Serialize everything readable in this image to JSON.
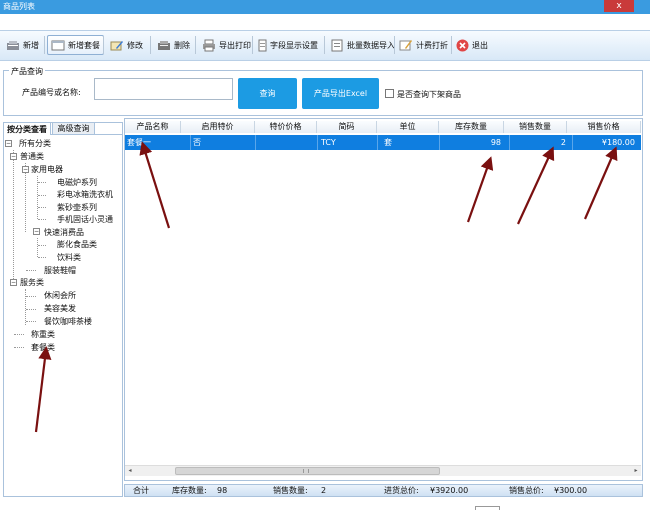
{
  "window": {
    "title": "商品列表",
    "close_glyph": "x"
  },
  "toolbar": {
    "items": [
      {
        "label": "新增",
        "icon": "add-icon"
      },
      {
        "label": "新增套餐",
        "icon": "package-add-icon"
      },
      {
        "label": "修改",
        "icon": "edit-icon"
      },
      {
        "label": "删除",
        "icon": "delete-icon"
      },
      {
        "label": "导出打印",
        "icon": "printer-icon"
      },
      {
        "label": "字段显示设置",
        "icon": "field-settings-icon"
      },
      {
        "label": "批量数据导入",
        "icon": "batch-import-icon"
      },
      {
        "label": "计费打折",
        "icon": "discount-icon"
      },
      {
        "label": "退出",
        "icon": "exit-icon"
      }
    ]
  },
  "query": {
    "legend": "产品查询",
    "code_label": "产品编号或名称:",
    "code_value": "",
    "query_button": "查询",
    "export_button": "产品导出Excel",
    "offshelf_label": "是否查询下架商品",
    "offshelf_checked": false
  },
  "left_tabs": {
    "by_category": "按分类查看",
    "advanced": "高级查询"
  },
  "tree": {
    "root": "所有分类",
    "normal": "普通类",
    "appliance": "家用电器",
    "appliance_children": [
      "电磁炉系列",
      "彩电冰箱洗衣机",
      "紫砂壶系列",
      "手机固话小灵通"
    ],
    "fmcg": "快速消费品",
    "fmcg_children": [
      "膨化食品类",
      "饮料类"
    ],
    "clothing": "服装鞋帽",
    "service": "服务类",
    "service_children": [
      "休闲会所",
      "美容美发",
      "餐饮咖啡茶楼"
    ],
    "weighing": "称重类",
    "package": "套餐类"
  },
  "grid": {
    "columns": [
      "产品名称",
      "启用特价",
      "特价价格",
      "简码",
      "单位",
      "库存数量",
      "销售数量",
      "销售价格"
    ],
    "rows": [
      [
        "套餐一",
        "否",
        "",
        "TCY",
        "套",
        "98",
        "2",
        "¥180.00"
      ]
    ]
  },
  "footer": {
    "total_label": "合计",
    "stock_label": "库存数量:",
    "stock_value": "98",
    "sales_label": "销售数量:",
    "sales_value": "2",
    "purchase_label": "进货总价:",
    "purchase_value": "¥3920.00",
    "sales_total_label": "销售总价:",
    "sales_total_value": "¥300.00"
  },
  "colors": {
    "accent": "#1c9be3",
    "selection": "#0f7ee0",
    "annotation_arrow": "#7a1010"
  }
}
